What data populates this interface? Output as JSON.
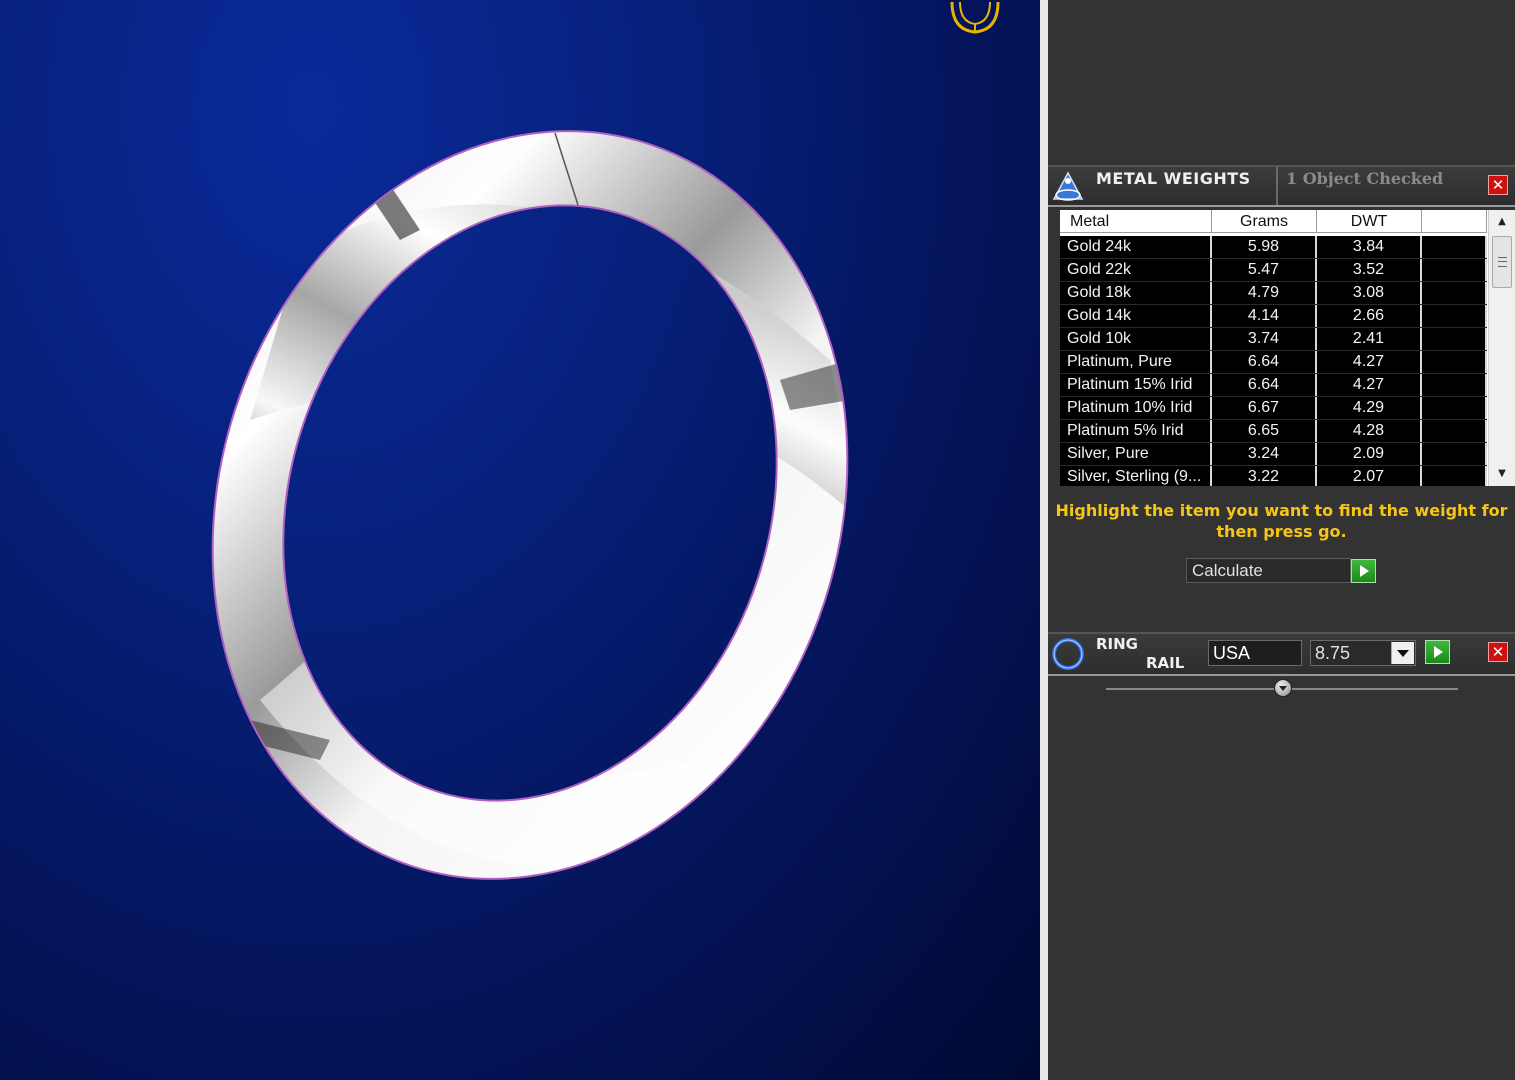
{
  "metal_weights": {
    "title": "METAL WEIGHTS",
    "status": "1 Object Checked",
    "close_label": "✕",
    "columns": [
      "Metal",
      "Grams",
      "DWT"
    ],
    "rows": [
      {
        "metal": "Gold 24k",
        "grams": "5.98",
        "dwt": "3.84"
      },
      {
        "metal": "Gold 22k",
        "grams": "5.47",
        "dwt": "3.52"
      },
      {
        "metal": "Gold 18k",
        "grams": "4.79",
        "dwt": "3.08"
      },
      {
        "metal": "Gold 14k",
        "grams": "4.14",
        "dwt": "2.66"
      },
      {
        "metal": "Gold 10k",
        "grams": "3.74",
        "dwt": "2.41"
      },
      {
        "metal": "Platinum, Pure",
        "grams": "6.64",
        "dwt": "4.27"
      },
      {
        "metal": "Platinum 15% Irid",
        "grams": "6.64",
        "dwt": "4.27"
      },
      {
        "metal": "Platinum 10% Irid",
        "grams": "6.67",
        "dwt": "4.29"
      },
      {
        "metal": "Platinum 5% Irid",
        "grams": "6.65",
        "dwt": "4.28"
      },
      {
        "metal": "Silver, Pure",
        "grams": "3.24",
        "dwt": "2.09"
      },
      {
        "metal": "Silver, Sterling (9...",
        "grams": "3.22",
        "dwt": "2.07"
      }
    ],
    "hint_line1": "Highlight the item you want to find the weight for",
    "hint_line2": "then press go.",
    "calculate_label": "Calculate"
  },
  "ring_rail": {
    "title_line1": "RING",
    "title_line2": "RAIL",
    "country": "USA",
    "size": "8.75",
    "close_label": "✕"
  },
  "colors": {
    "viewport_bg": "#06207a",
    "panel_bg": "#333333",
    "hint_text": "#f5c518",
    "go_green": "#2aa02a",
    "close_red": "#cc1111"
  },
  "icons": [
    "ring-model",
    "axis-gizmo-icon",
    "metal-weights-icon",
    "ring-rail-icon",
    "close-icon",
    "go-arrow-icon",
    "dropdown-arrow-icon"
  ]
}
